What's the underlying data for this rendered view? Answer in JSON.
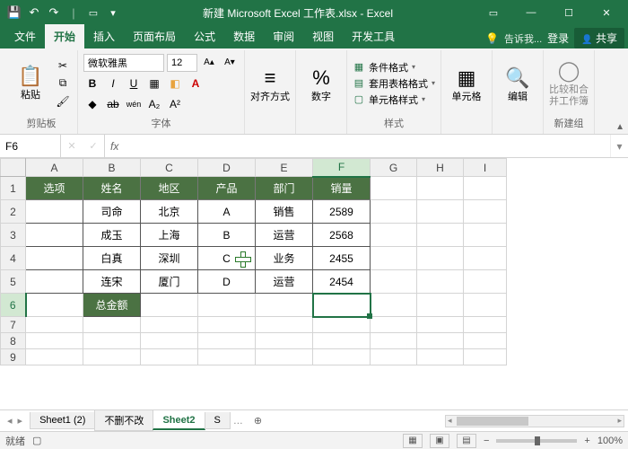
{
  "titlebar": {
    "title": "新建 Microsoft Excel 工作表.xlsx - Excel"
  },
  "tabs": {
    "file": "文件",
    "home": "开始",
    "insert": "插入",
    "layout": "页面布局",
    "formula": "公式",
    "data": "数据",
    "review": "审阅",
    "view": "视图",
    "dev": "开发工具",
    "tellme": "告诉我...",
    "login": "登录",
    "share": "共享"
  },
  "ribbon": {
    "clipboard": {
      "paste": "粘贴",
      "label": "剪贴板"
    },
    "font": {
      "name": "微软雅黑",
      "size": "12",
      "label": "字体"
    },
    "align": {
      "btn": "对齐方式"
    },
    "number": {
      "btn": "数字"
    },
    "styles": {
      "cond": "条件格式",
      "table": "套用表格格式",
      "cell": "单元格样式",
      "label": "样式"
    },
    "cells": {
      "btn": "单元格"
    },
    "edit": {
      "btn": "编辑"
    },
    "newgrp": {
      "btn": "比较和合并工作簿",
      "label": "新建组"
    }
  },
  "refbar": {
    "name": "F6",
    "formula": ""
  },
  "table": {
    "cols": [
      "A",
      "B",
      "C",
      "D",
      "E",
      "F",
      "G",
      "H",
      "I"
    ],
    "headers": {
      "A": "选项",
      "B": "姓名",
      "C": "地区",
      "D": "产品",
      "E": "部门",
      "F": "销量"
    },
    "rows": [
      {
        "B": "司命",
        "C": "北京",
        "D": "A",
        "E": "销售",
        "F": "2589"
      },
      {
        "B": "成玉",
        "C": "上海",
        "D": "B",
        "E": "运营",
        "F": "2568"
      },
      {
        "B": "白真",
        "C": "深圳",
        "D": "C",
        "E": "业务",
        "F": "2455"
      },
      {
        "B": "连宋",
        "C": "厦门",
        "D": "D",
        "E": "运营",
        "F": "2454"
      }
    ],
    "total_label": "总金额"
  },
  "sheets": {
    "s1": "Sheet1 (2)",
    "s2": "不删不改",
    "s3": "Sheet2",
    "s4": "S"
  },
  "status": {
    "ready": "就绪",
    "rec": "",
    "zoom": "100%"
  }
}
